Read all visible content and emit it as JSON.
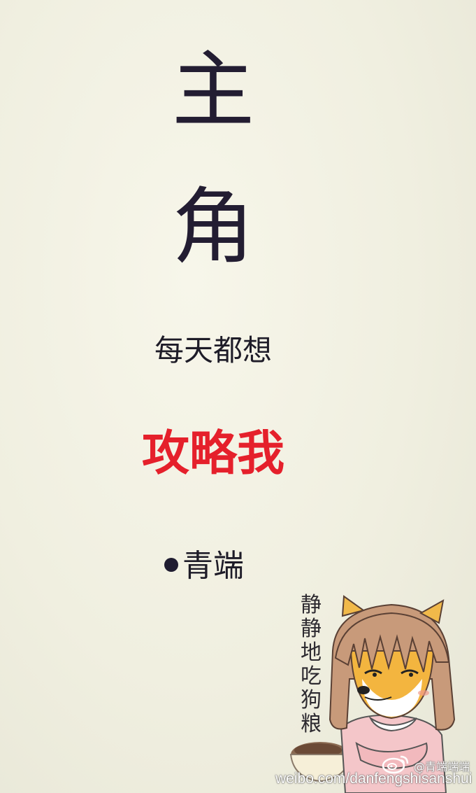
{
  "poster": {
    "title_char_1": "主",
    "title_char_2": "角",
    "line1": "每天都想",
    "line2": "攻略我",
    "author": "青端"
  },
  "illustration": {
    "caption_vertical": "静静地吃狗粮",
    "icon": "shiba-girl-eating-dog-food"
  },
  "watermark": {
    "handle": "@青端端端",
    "url": "weibo.com/danfengshisanshui",
    "icon": "weibo-logo"
  },
  "colors": {
    "background": "#f0efe0",
    "primary_text": "#231d32",
    "accent_red": "#e5202b"
  }
}
